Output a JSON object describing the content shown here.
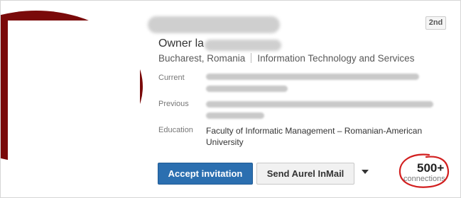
{
  "profile": {
    "degree_badge": "2nd",
    "headline": "Owner la",
    "location": "Bucharest, Romania",
    "industry": "Information Technology and Services"
  },
  "info": {
    "current_label": "Current",
    "previous_label": "Previous",
    "education_label": "Education",
    "education_value": "Faculty of Informatic Management – Romanian-American University"
  },
  "actions": {
    "accept_label": "Accept invitation",
    "inmail_label": "Send Aurel InMail"
  },
  "connections": {
    "count": "500+",
    "label": "connections"
  },
  "colors": {
    "accent": "#2b6fb0",
    "annotation": "#d21f1f",
    "photo_ring": "#7a0a0a"
  }
}
